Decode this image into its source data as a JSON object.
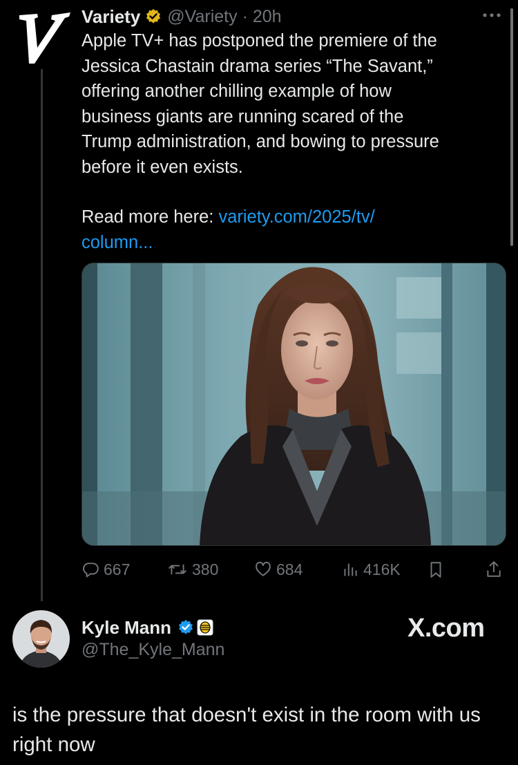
{
  "tweet": {
    "author_name": "Variety",
    "handle_time": "@Variety · 20h",
    "text": "Apple TV+ has postponed the premiere of the\nJessica Chastain drama series “The Savant,”\noffering another chilling example of how\nbusiness giants are running scared of the\nTrump administration, and bowing to pressure\nbefore it even exists.",
    "read_more_label": "Read more here: ",
    "link_text_1": "variety.com/2025/tv/",
    "link_text_2": "column...",
    "media_icon": "photo-woman-dark-coat",
    "stats": {
      "replies": "667",
      "reposts": "380",
      "likes": "684",
      "views": "416K"
    }
  },
  "reply_author": {
    "name": "Kyle Mann",
    "handle": "@The_Kyle_Mann"
  },
  "watermark": "X.com",
  "caption": "is the pressure that doesn't exist in the room with us right now",
  "colors": {
    "background": "#000000",
    "text": "#e7e9ea",
    "secondary": "#71767b",
    "link": "#1d9bf0",
    "gold_badge": "#e2b719",
    "blue_badge": "#1d9bf0"
  }
}
